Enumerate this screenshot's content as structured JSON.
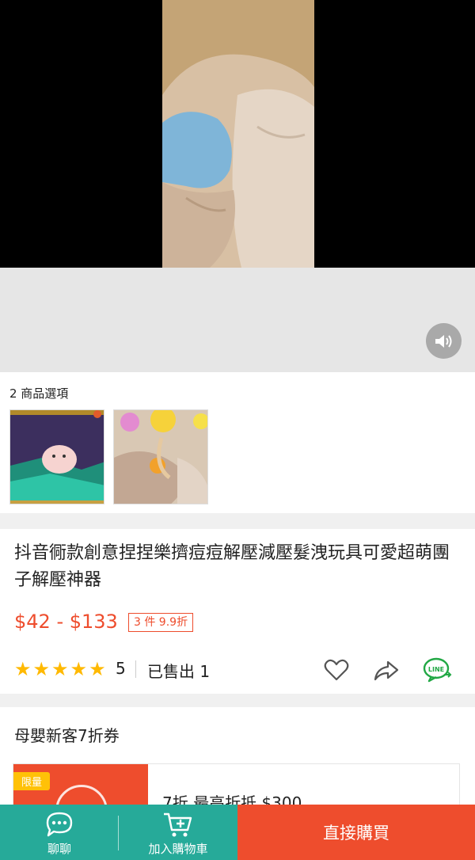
{
  "variants": {
    "title": "2 商品選項"
  },
  "product": {
    "title": "抖音衕款創意捏捏樂擠痘痘解壓減壓髮洩玩具可愛超萌團子解壓神器",
    "price": "$42 - $133",
    "promo": "3 件 9.9折",
    "rating": "5",
    "sold": "已售出 1"
  },
  "voucher": {
    "section_title": "母嬰新客7折券",
    "limited_label": "限量",
    "detail": "7折 最高折抵 $300"
  },
  "bottom_bar": {
    "chat_label": "聊聊",
    "cart_label": "加入購物車",
    "buy_label": "直接購買"
  },
  "colors": {
    "brand": "#ee4d2d",
    "teal": "#26aa99",
    "star": "#ffb900"
  },
  "icons": [
    "volume-icon",
    "heart-icon",
    "share-icon",
    "line-icon",
    "chat-icon",
    "cart-icon",
    "star-icon"
  ]
}
